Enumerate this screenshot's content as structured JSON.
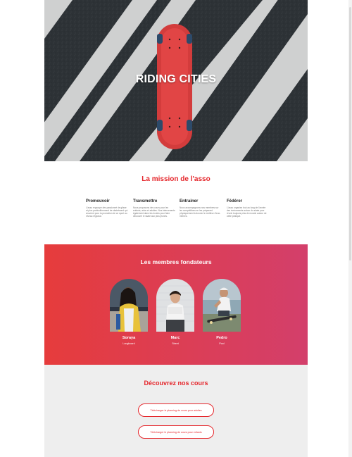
{
  "hero": {
    "title": "RIDING CITIES"
  },
  "mission": {
    "title": "La mission de l'asso",
    "columns": [
      {
        "heading": "Promouvoir",
        "text": "L'asso regroupe des passionné de glisse et plus particulièrement de skateboard qui œuvrent pour la promotion de ce sport au niveau régional."
      },
      {
        "heading": "Transmettre",
        "text": "Nous proposons des cours pour les enfants, ados et adultes. Nos intervenants également dans les écoles pour faire découvrir le skate aux plus jeunes."
      },
      {
        "heading": "Entrainer",
        "text": "Nous accompagnons nos membres sur les compétitions en les préparant physiquement à donner le meilleur d'eux-mêmes."
      },
      {
        "heading": "Fédérer",
        "text": "L'asso organise tout au long de l'année des événements autour du skate pour réunir toujours plus de monde autour de cette pratique."
      }
    ]
  },
  "founders": {
    "title": "Les membres fondateurs",
    "members": [
      {
        "name": "Soraya",
        "role": "Longboard"
      },
      {
        "name": "Marc",
        "role": "Street"
      },
      {
        "name": "Pedro",
        "role": "Pool"
      }
    ]
  },
  "courses": {
    "title": "Découvrez nos cours",
    "buttons": [
      "Télécharger le planning de cours pour adultes",
      "Télécharger le planning de cours pour enfants"
    ]
  },
  "colors": {
    "accent": "#e5262b",
    "gradient_start": "#e63c3c",
    "gradient_end": "#d33f6b"
  }
}
